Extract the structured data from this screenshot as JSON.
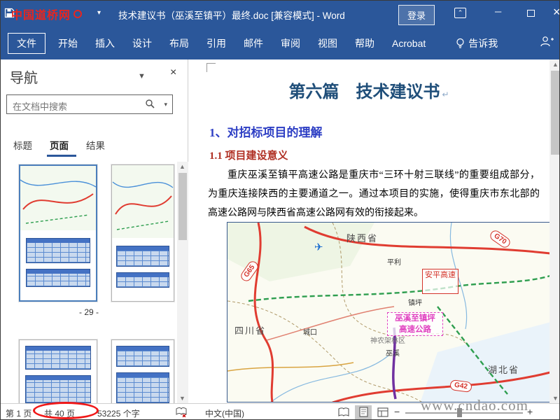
{
  "colors": {
    "titlebar_blue": "#2b579a",
    "heading_blue": "#1f4e79",
    "subheading_blue": "#2d3ec4",
    "subheading_red": "#b03024",
    "annotation_red": "#f01818",
    "map_road_red": "#e03c31",
    "map_route_green": "#2e9e4f",
    "map_label_magenta": "#e040c0"
  },
  "annotations": {
    "site_watermark": "中国道桥网",
    "url_watermark": "www.cndao.com"
  },
  "title_bar": {
    "document_title": "技术建议书（巫溪至镇平）最终.doc [兼容模式] - Word",
    "sign_in_label": "登录"
  },
  "ribbon": {
    "tabs": [
      "文件",
      "开始",
      "插入",
      "设计",
      "布局",
      "引用",
      "邮件",
      "审阅",
      "视图",
      "帮助",
      "Acrobat"
    ],
    "tell_me_label": "告诉我"
  },
  "nav_pane": {
    "title": "导航",
    "search_placeholder": "在文档中搜索",
    "tabs": [
      "标题",
      "页面",
      "结果"
    ],
    "active_tab": "页面",
    "thumbnail_page_label": "- 29 -"
  },
  "document": {
    "section_title": "第六篇　技术建议书",
    "heading_1": "1、对招标项目的理解",
    "heading_1_1": "1.1 项目建设意义",
    "paragraph": "重庆巫溪至镇平高速公路是重庆市“三环十射三联线”的重要组成部分，为重庆连接陕西的主要通道之一。通过本项目的实施，使得重庆市东北部的高速公路网与陕西省高速公路网有效的衔接起来。",
    "map": {
      "province_shaanxi": "陕西省",
      "province_sichuan": "四川省",
      "province_hubei": "湖北省",
      "area_shennongjia": "神农架林区",
      "badge_g70": "G70",
      "badge_g65": "G65",
      "badge_g42": "G42",
      "route_box_line1": "巫溪至镇坪",
      "route_box_line2": "高速公路",
      "red_box_label": "安平高速",
      "county_pingli": "平利",
      "county_zhenping": "镇坪",
      "county_wuxi": "巫溪",
      "county_chengkou": "城口"
    }
  },
  "status_bar": {
    "page_indicator": "第 1 页",
    "page_total": "共 40 页",
    "word_count": "53225 个字",
    "language": "中文(中国)"
  }
}
